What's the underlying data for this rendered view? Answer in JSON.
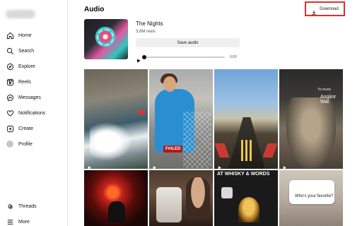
{
  "sidebar": {
    "items": [
      {
        "label": "Home",
        "icon": "home-icon"
      },
      {
        "label": "Search",
        "icon": "search-icon"
      },
      {
        "label": "Explore",
        "icon": "compass-icon"
      },
      {
        "label": "Reels",
        "icon": "reels-icon"
      },
      {
        "label": "Messages",
        "icon": "messenger-icon"
      },
      {
        "label": "Notifications",
        "icon": "heart-icon"
      },
      {
        "label": "Create",
        "icon": "plus-square-icon"
      },
      {
        "label": "Profile",
        "icon": "avatar"
      }
    ],
    "bottom": [
      {
        "label": "Threads",
        "icon": "threads-icon"
      },
      {
        "label": "More",
        "icon": "menu-icon"
      }
    ]
  },
  "header": {
    "title": "Audio",
    "download_label": "Download"
  },
  "audio": {
    "title": "The Nights",
    "reels_count": "3.8M reels",
    "save_label": "Save audio",
    "time": "0:00",
    "progress": 0
  },
  "grid": {
    "tiles": [
      {
        "overlay": ""
      },
      {
        "overlay": "FAILED"
      },
      {
        "overlay": ""
      },
      {
        "overlay": "Angkor Wat",
        "brand": "Yo.muse"
      },
      {
        "overlay": ""
      },
      {
        "overlay": ""
      },
      {
        "overlay": "AT WHISKY & WORDS"
      },
      {
        "overlay": "Who's your favorite?"
      }
    ]
  },
  "colors": {
    "highlight": "#e0302c",
    "text": "#111111",
    "muted": "#555555",
    "button_bg": "#efefef"
  }
}
